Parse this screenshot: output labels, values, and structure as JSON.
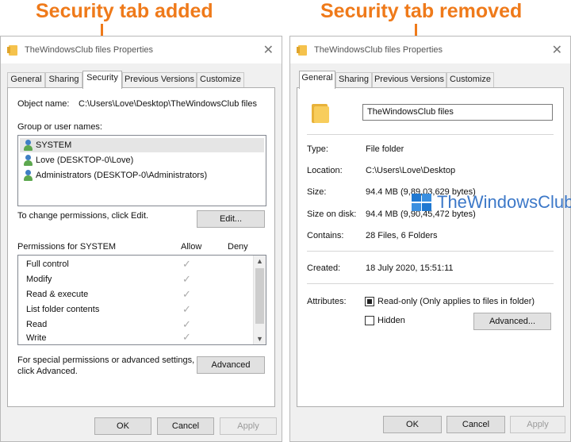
{
  "headlines": {
    "left": "Security tab added",
    "right": "Security tab removed"
  },
  "colors": {
    "headline": "#ef7a1a",
    "watermark": "#3c78c8"
  },
  "left_dialog": {
    "title": "TheWindowsClub files Properties",
    "tabs": [
      {
        "label": "General"
      },
      {
        "label": "Sharing"
      },
      {
        "label": "Security",
        "active": true
      },
      {
        "label": "Previous Versions"
      },
      {
        "label": "Customize"
      }
    ],
    "object_name_label": "Object name:",
    "object_name_value": "C:\\Users\\Love\\Desktop\\TheWindowsClub files",
    "group_label": "Group or user names:",
    "users": [
      {
        "name": "SYSTEM",
        "selected": true
      },
      {
        "name": "Love (DESKTOP-0\\Love)"
      },
      {
        "name": "Administrators (DESKTOP-0\\Administrators)"
      }
    ],
    "change_perm_text": "To change permissions, click Edit.",
    "edit_button": "Edit...",
    "permissions_for": "Permissions for SYSTEM",
    "allow_header": "Allow",
    "deny_header": "Deny",
    "permissions": [
      {
        "name": "Full control",
        "allow": true
      },
      {
        "name": "Modify",
        "allow": true
      },
      {
        "name": "Read & execute",
        "allow": true
      },
      {
        "name": "List folder contents",
        "allow": true
      },
      {
        "name": "Read",
        "allow": true
      },
      {
        "name": "Write",
        "allow": true
      }
    ],
    "special_text_1": "For special permissions or advanced settings,",
    "special_text_2": "click Advanced.",
    "advanced_button": "Advanced",
    "ok": "OK",
    "cancel": "Cancel",
    "apply": "Apply"
  },
  "right_dialog": {
    "title": "TheWindowsClub files Properties",
    "tabs": [
      {
        "label": "General",
        "active": true
      },
      {
        "label": "Sharing"
      },
      {
        "label": "Previous Versions"
      },
      {
        "label": "Customize"
      }
    ],
    "folder_name": "TheWindowsClub files",
    "properties": [
      {
        "label": "Type:",
        "value": "File folder"
      },
      {
        "label": "Location:",
        "value": "C:\\Users\\Love\\Desktop"
      },
      {
        "label": "Size:",
        "value": "94.4 MB (9,89,03,629 bytes)"
      },
      {
        "label": "Size on disk:",
        "value": "94.4 MB (9,90,45,472 bytes)"
      },
      {
        "label": "Contains:",
        "value": "28 Files, 6 Folders"
      }
    ],
    "created_label": "Created:",
    "created_value": "18 July 2020, 15:51:11",
    "attributes_label": "Attributes:",
    "readonly_label": "Read-only (Only applies to files in folder)",
    "readonly_checked": true,
    "hidden_label": "Hidden",
    "hidden_checked": false,
    "advanced_button": "Advanced...",
    "ok": "OK",
    "cancel": "Cancel",
    "apply": "Apply"
  },
  "watermark": {
    "text": "TheWindowsClub",
    "icon": "windows-logo-icon"
  }
}
